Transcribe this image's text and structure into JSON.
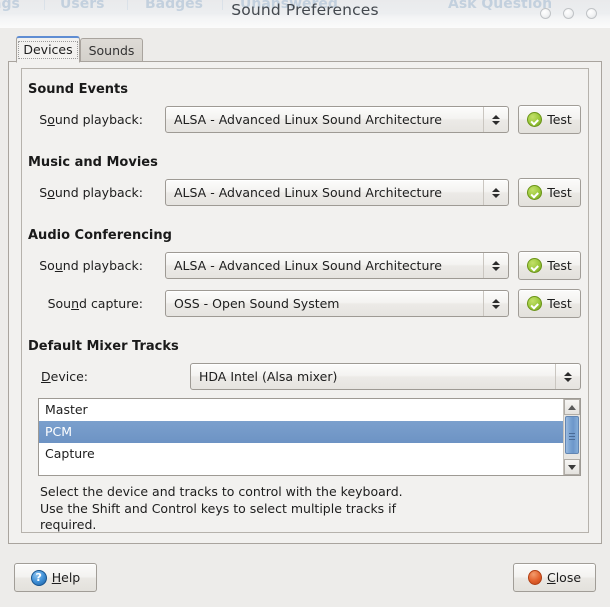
{
  "window": {
    "title": "Sound Preferences",
    "backdrop_nav": [
      "ags",
      "Users",
      "Badges",
      "Unanswered",
      "Ask Question"
    ],
    "buttons": [
      "minimize-button",
      "maximize-button",
      "close-window-button"
    ]
  },
  "tabs": [
    {
      "label": "Devices",
      "active": true
    },
    {
      "label": "Sounds",
      "active": false
    }
  ],
  "sections": {
    "sound_events": {
      "heading": "Sound Events",
      "playback": {
        "label_pre": "S",
        "label_mn": "o",
        "label_post": "und playback:",
        "value": "ALSA - Advanced Linux Sound Architecture",
        "test_label": "Test"
      }
    },
    "music_and_movies": {
      "heading": "Music and Movies",
      "playback": {
        "label_pre": "S",
        "label_mn": "o",
        "label_post": "und playback:",
        "value": "ALSA - Advanced Linux Sound Architecture",
        "test_label": "Test"
      }
    },
    "audio_conferencing": {
      "heading": "Audio Conferencing",
      "playback": {
        "label_pre": "So",
        "label_mn": "u",
        "label_post": "nd playback:",
        "value": "ALSA - Advanced Linux Sound Architecture",
        "test_label": "Test"
      },
      "capture": {
        "label_pre": "Sou",
        "label_mn": "n",
        "label_post": "d capture:",
        "value": "OSS - Open Sound System",
        "test_label": "Test"
      }
    },
    "default_mixer_tracks": {
      "heading": "Default Mixer Tracks",
      "device": {
        "label_pre": "",
        "label_mn": "D",
        "label_post": "evice:",
        "value": "HDA Intel (Alsa mixer)"
      },
      "tracks": [
        {
          "name": "Master",
          "selected": false
        },
        {
          "name": "PCM",
          "selected": true
        },
        {
          "name": "Capture",
          "selected": false
        }
      ],
      "help_text": "Select the device and tracks to control with the keyboard.\nUse the Shift and Control keys to select multiple tracks if\nrequired."
    }
  },
  "actions": {
    "help": {
      "pre": "",
      "mn": "H",
      "post": "elp"
    },
    "close": {
      "pre": "",
      "mn": "C",
      "post": "lose"
    }
  },
  "colors": {
    "window_bg": "#edecea",
    "page_bg": "#f2f1ef",
    "selection_blue": "#6d93c4",
    "active_tab_accent": "#5f8dd3",
    "test_icon_green": "#9ac83a",
    "help_icon_blue": "#3e8fd6",
    "close_icon_orange": "#e2602c"
  }
}
